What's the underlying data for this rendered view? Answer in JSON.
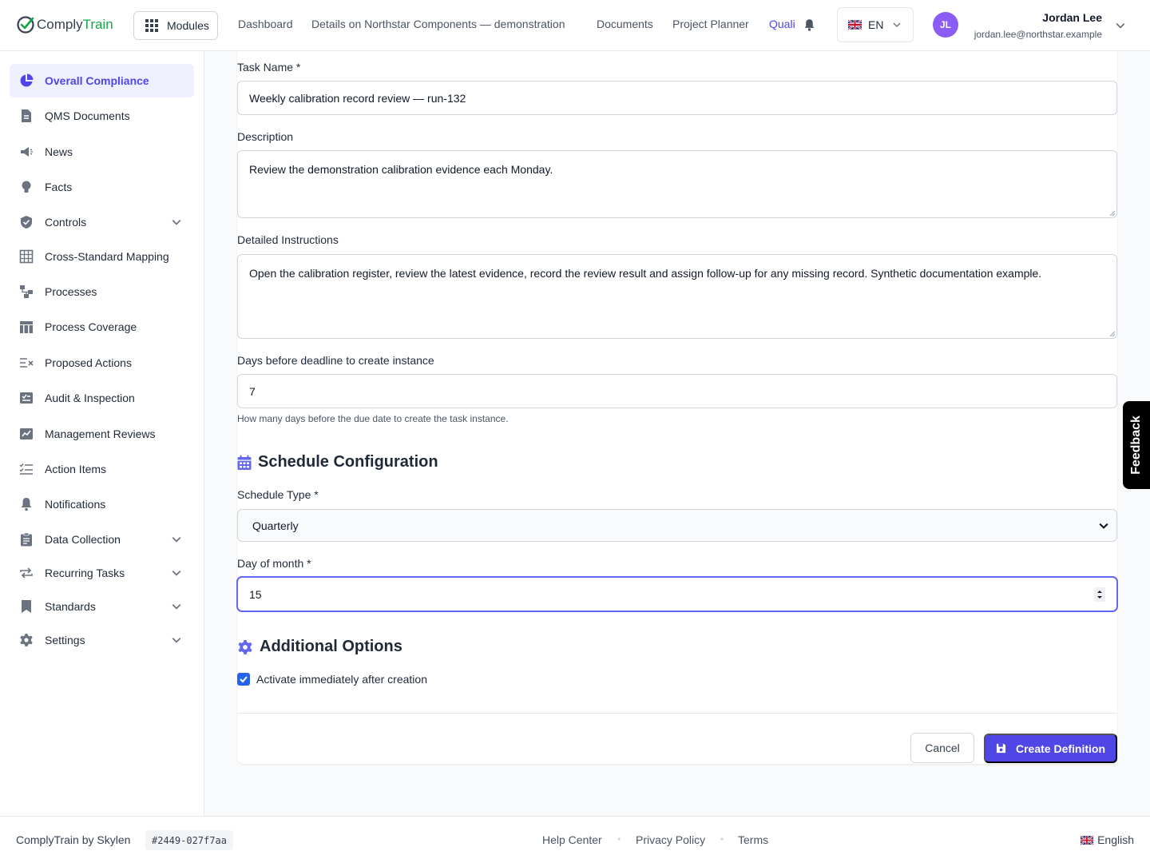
{
  "header": {
    "logo_part1": "Comply",
    "logo_part2": "Train",
    "modules_label": "Modules",
    "nav": [
      "Dashboard",
      "Details on Northstar Components — demonstration",
      "Documents",
      "Project Planner",
      "Quali"
    ],
    "language": "EN",
    "user": {
      "initials": "JL",
      "name": "Jordan Lee",
      "email": "jordan.lee@northstar.example"
    }
  },
  "sidebar": {
    "items": [
      {
        "label": "Overall Compliance",
        "icon": "pie-chart-icon",
        "active": true
      },
      {
        "label": "QMS Documents",
        "icon": "document-icon"
      },
      {
        "label": "News",
        "icon": "megaphone-icon"
      },
      {
        "label": "Facts",
        "icon": "lightbulb-icon"
      },
      {
        "label": "Controls",
        "icon": "shield-check-icon",
        "expandable": true
      },
      {
        "label": "Cross-Standard Mapping",
        "icon": "table-grid-icon"
      },
      {
        "label": "Processes",
        "icon": "process-flow-icon"
      },
      {
        "label": "Process Coverage",
        "icon": "table-layout-icon"
      },
      {
        "label": "Proposed Actions",
        "icon": "list-x-icon"
      },
      {
        "label": "Audit & Inspection",
        "icon": "clipboard-check-icon"
      },
      {
        "label": "Management Reviews",
        "icon": "review-chart-icon"
      },
      {
        "label": "Action Items",
        "icon": "checklist-icon"
      },
      {
        "label": "Notifications",
        "icon": "bell-icon"
      },
      {
        "label": "Data Collection",
        "icon": "clipboard-icon",
        "expandable": true
      },
      {
        "label": "Recurring Tasks",
        "icon": "repeat-icon",
        "expandable": true
      },
      {
        "label": "Standards",
        "icon": "bookmark-icon",
        "expandable": true
      },
      {
        "label": "Settings",
        "icon": "gear-icon",
        "expandable": true
      }
    ]
  },
  "form": {
    "task_name_label": "Task Name *",
    "task_name_value": "Weekly calibration record review — run-132",
    "description_label": "Description",
    "description_value": "Review the demonstration calibration evidence each Monday.",
    "instructions_label": "Detailed Instructions",
    "instructions_value": "Open the calibration register, review the latest evidence, record the review result and assign follow-up for any missing record. Synthetic documentation example.",
    "days_label": "Days before deadline to create instance",
    "days_value": "7",
    "days_hint": "How many days before the due date to create the task instance.",
    "schedule_title": "Schedule Configuration",
    "schedule_type_label": "Schedule Type *",
    "schedule_type_value": "Quarterly",
    "day_of_month_label": "Day of month *",
    "day_of_month_value": "15",
    "options_title": "Additional Options",
    "activate_label": "Activate immediately after creation",
    "activate_checked": true,
    "cancel_label": "Cancel",
    "create_label": "Create Definition"
  },
  "feedback_label": "Feedback",
  "footer": {
    "brand": "ComplyTrain by Skylen",
    "build": "#2449-027f7aa",
    "links": [
      "Help Center",
      "Privacy Policy",
      "Terms"
    ],
    "language": "English"
  },
  "colors": {
    "accent": "#4f46e5",
    "brand_green": "#16a34a",
    "checkbox": "#2563eb"
  }
}
